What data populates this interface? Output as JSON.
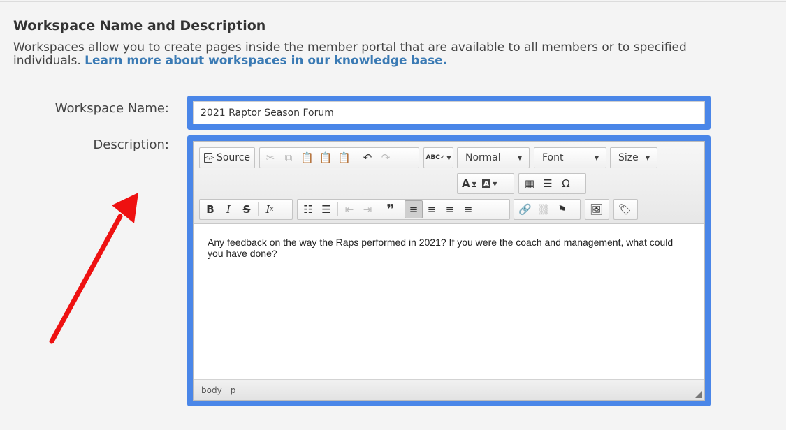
{
  "section": {
    "title": "Workspace Name and Description",
    "description": "Workspaces allow you to create pages inside the member portal that are available to all members or to specified individuals.",
    "link_text": "Learn more about workspaces in our knowledge base."
  },
  "form": {
    "name_label": "Workspace Name:",
    "name_value": "2021 Raptor Season Forum",
    "description_label": "Description:"
  },
  "editor": {
    "toolbar": {
      "source_label": "Source",
      "format_value": "Normal",
      "font_value": "Font",
      "size_value": "Size",
      "spellcheck_label": "ABC"
    },
    "icons": [
      "source-icon",
      "cut-icon",
      "copy-icon",
      "paste-icon",
      "paste-text-icon",
      "paste-word-icon",
      "undo-icon",
      "redo-icon",
      "spellcheck-icon",
      "text-color-icon",
      "background-color-icon",
      "table-icon",
      "horizontal-rule-icon",
      "special-char-icon",
      "bold-icon",
      "italic-icon",
      "strike-icon",
      "remove-format-icon",
      "numbered-list-icon",
      "bulleted-list-icon",
      "outdent-icon",
      "indent-icon",
      "blockquote-icon",
      "align-left-icon",
      "align-center-icon",
      "align-right-icon",
      "justify-icon",
      "link-icon",
      "unlink-icon",
      "anchor-icon",
      "image-icon",
      "tag-icon"
    ],
    "content": "Any feedback on the way the Raps performed in 2021? If you were the coach and management, what could you have done?",
    "status_path": [
      "body",
      "p"
    ]
  },
  "colors": {
    "highlight_frame": "#4a86e8",
    "link": "#3a7ab4",
    "annotation_arrow": "#ee1111"
  }
}
